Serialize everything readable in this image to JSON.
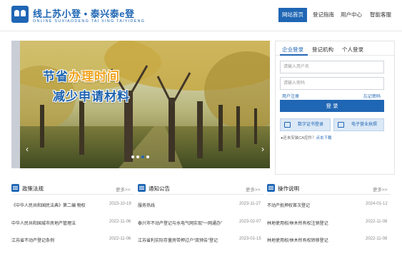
{
  "header": {
    "title": "线上苏小登 • 泰兴泰e登",
    "subtitle": "ONLINE SUXIAODENG TAI XING TAIYIDENG",
    "nav": [
      "网站首页",
      "登记指南",
      "用户中心",
      "智能客服"
    ]
  },
  "hero": {
    "slogan_line1_a": "节省",
    "slogan_line1_b": "办理时间",
    "slogan_line2": "减少申请材料",
    "prev_icon": "chevron-left-icon",
    "next_icon": "chevron-right-icon",
    "slide_count": 4,
    "active_slide": 2
  },
  "login": {
    "tabs": [
      "企业登录",
      "登记机构",
      "个人登录"
    ],
    "active_tab": 0,
    "username_placeholder": "请输入用户名",
    "password_placeholder": "请输入密码",
    "register": "用户注册",
    "forgot": "忘记密码",
    "login_button": "登 录",
    "ca_button": "数字证书登录",
    "ecert_button": "电子营业执照",
    "ca_note": "●还未安装CA控件？",
    "ca_download": "点击下载"
  },
  "columns": [
    {
      "title": "政策法规",
      "more": "更多>>",
      "icon": "policy-icon",
      "items": [
        {
          "text": "《中华人民共和国民法典》第二编 物权",
          "date": "2023-10-19"
        },
        {
          "text": "中华人民共和国城市房地产管理法",
          "date": "2022-11-06"
        },
        {
          "text": "江苏省不动产登记条例",
          "date": "2022-11-06"
        }
      ]
    },
    {
      "title": "通知公告",
      "more": "更多>>",
      "icon": "notice-icon",
      "items": [
        {
          "text": "服务热线",
          "date": "2023-11-27"
        },
        {
          "text": "泰兴市不动产登记与水电气网实现“一网通办”",
          "date": "2023-02-07"
        },
        {
          "text": "江苏省利实际存量房带押过户“双预告”登记",
          "date": "2023-01-15"
        }
      ]
    },
    {
      "title": "操作说明",
      "more": "更多>>",
      "icon": "guide-icon",
      "items": [
        {
          "text": "不动产抵押权首次登记",
          "date": "2024-01-12"
        },
        {
          "text": "林地使用权/林木所有权注销登记",
          "date": "2022-11-08"
        },
        {
          "text": "林地使用权/林木所有权转移登记",
          "date": "2022-11-08"
        }
      ]
    }
  ]
}
